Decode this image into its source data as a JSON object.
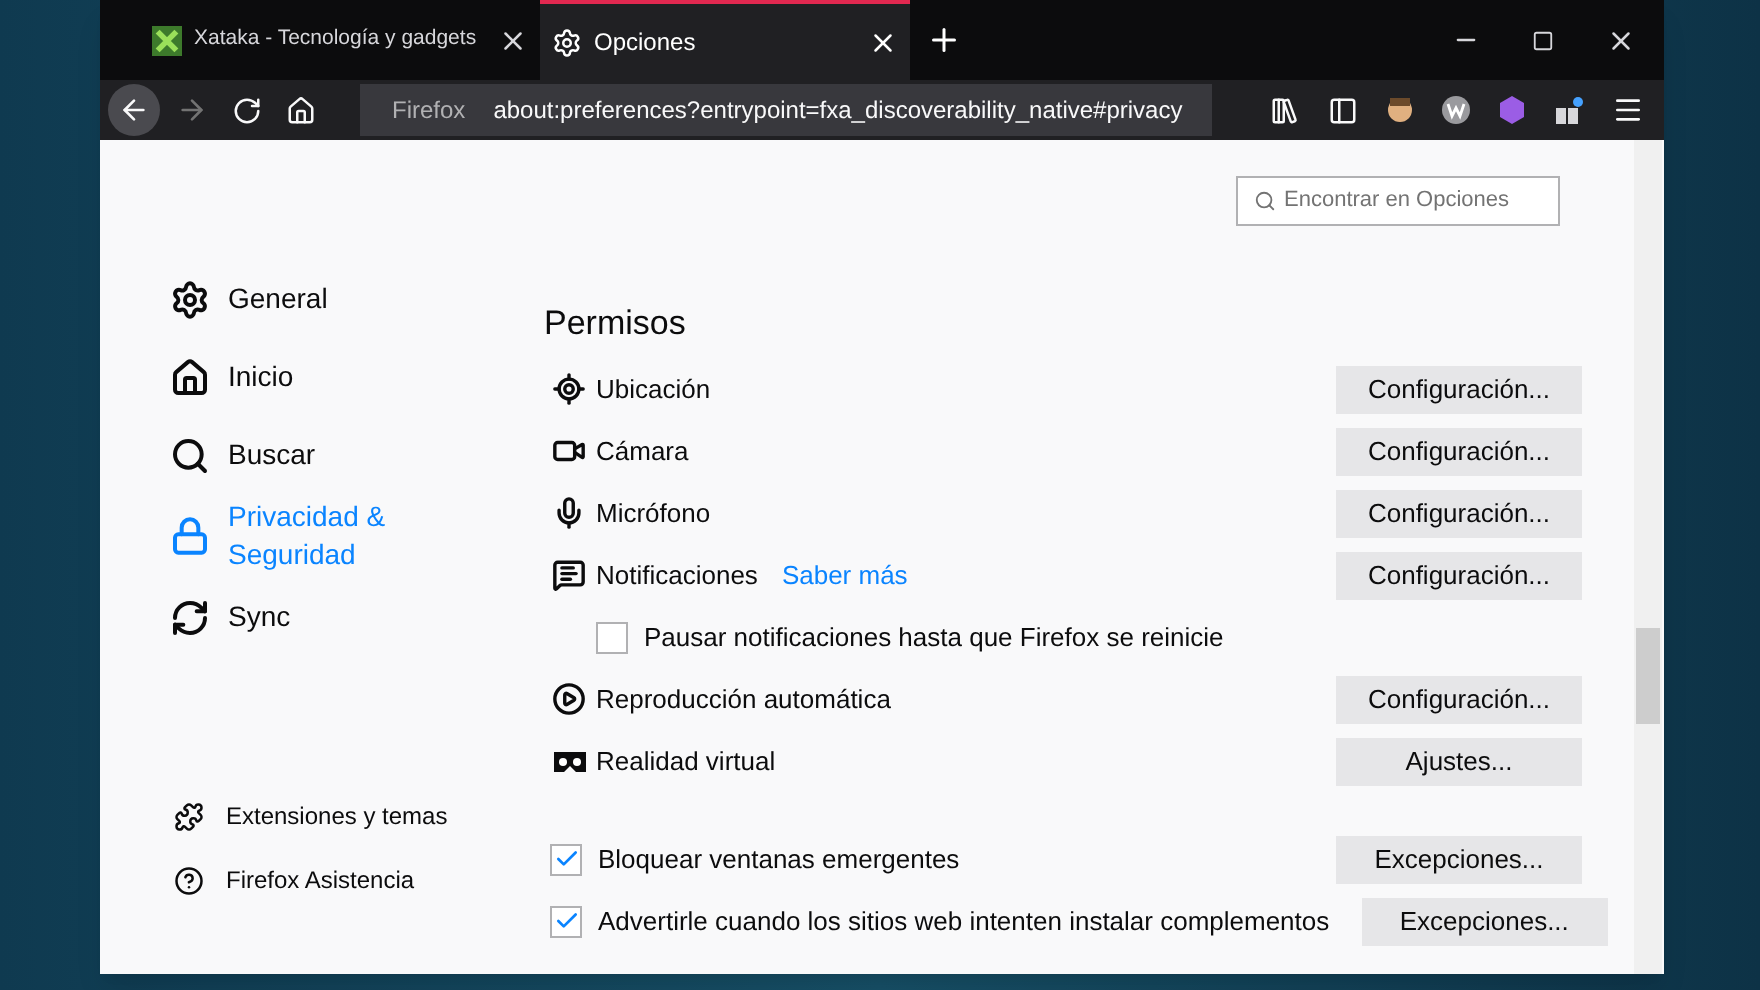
{
  "tabs": [
    {
      "title": "Xataka - Tecnología y gadgets",
      "kind": "site",
      "selected": false
    },
    {
      "title": "Opciones",
      "kind": "settings",
      "selected": true
    }
  ],
  "address_bar": {
    "identity": "Firefox",
    "url": "about:preferences?entrypoint=fxa_discoverability_native#privacy"
  },
  "search": {
    "placeholder": "Encontrar en Opciones"
  },
  "sidebar": {
    "items": [
      {
        "label": "General",
        "kind": "general",
        "selected": false
      },
      {
        "label": "Inicio",
        "kind": "home",
        "selected": false
      },
      {
        "label": "Buscar",
        "kind": "search",
        "selected": false
      },
      {
        "label": "Privacidad & Seguridad",
        "kind": "privacy",
        "selected": true
      },
      {
        "label": "Sync",
        "kind": "sync",
        "selected": false
      }
    ],
    "footer": [
      {
        "label": "Extensiones y temas",
        "kind": "extensions"
      },
      {
        "label": "Firefox Asistencia",
        "kind": "help"
      }
    ]
  },
  "section": {
    "title": "Permisos",
    "rows": [
      {
        "kind": "permission",
        "label": "Ubicación",
        "button": "Configuración..."
      },
      {
        "kind": "permission",
        "label": "Cámara",
        "button": "Configuración..."
      },
      {
        "kind": "permission",
        "label": "Micrófono",
        "button": "Configuración..."
      },
      {
        "kind": "permission",
        "label": "Notificaciones",
        "link": "Saber más",
        "button": "Configuración..."
      },
      {
        "kind": "subcheck",
        "label": "Pausar notificaciones hasta que Firefox se reinicie",
        "checked": false
      },
      {
        "kind": "permission",
        "label": "Reproducción automática",
        "button": "Configuración..."
      },
      {
        "kind": "permission",
        "label": "Realidad virtual",
        "button": "Ajustes..."
      },
      {
        "kind": "checkbox",
        "label": "Bloquear ventanas emergentes",
        "checked": true,
        "button": "Excepciones..."
      },
      {
        "kind": "checkbox",
        "label": "Advertirle cuando los sitios web intenten instalar complementos",
        "checked": true,
        "button": "Excepciones..."
      }
    ]
  }
}
